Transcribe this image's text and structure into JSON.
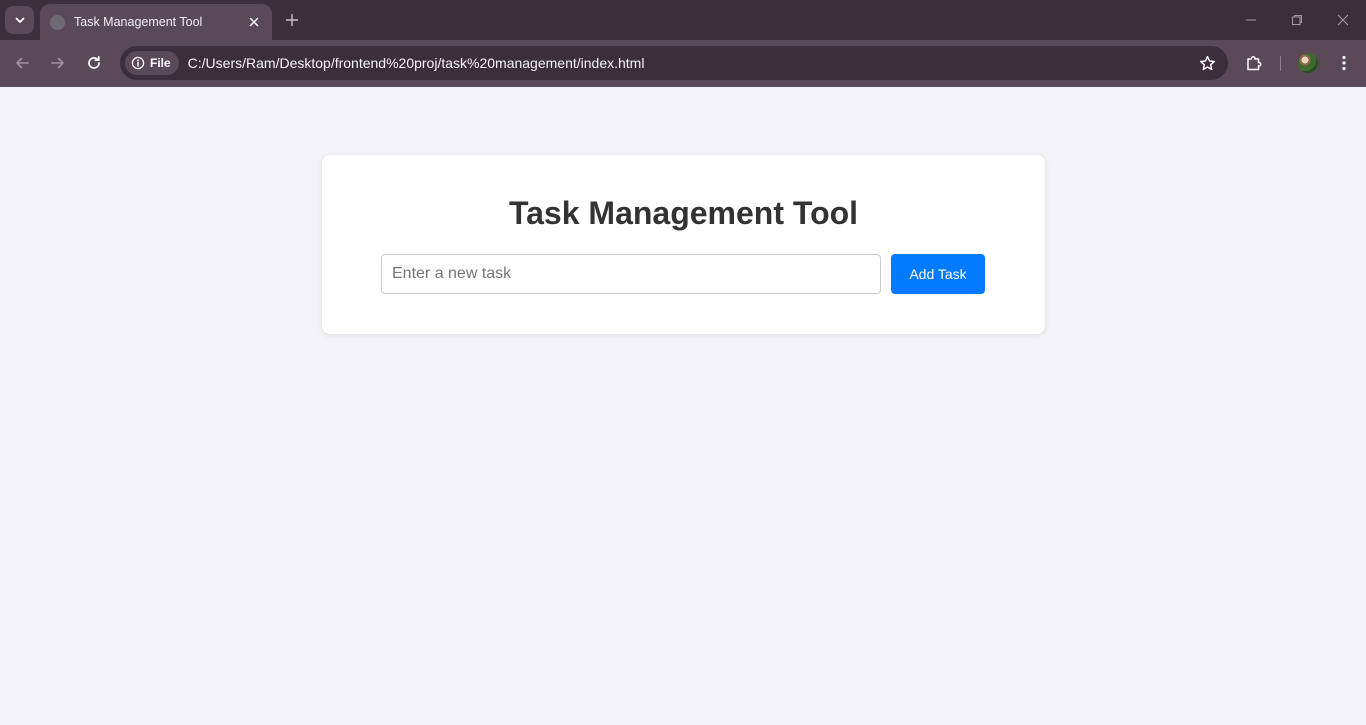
{
  "browser": {
    "tab": {
      "title": "Task Management Tool"
    },
    "address_bar": {
      "site_chip_label": "File",
      "url": "C:/Users/Ram/Desktop/frontend%20proj/task%20management/index.html"
    },
    "colors": {
      "tabstrip": "#3c2f3a",
      "toolbar": "#5a4957"
    }
  },
  "page": {
    "title": "Task Management Tool",
    "task_input": {
      "value": "",
      "placeholder": "Enter a new task"
    },
    "add_button_label": "Add Task",
    "colors": {
      "background": "#f4f4f8",
      "card": "#ffffff",
      "accent": "#007bff",
      "title_text": "#333333"
    }
  }
}
